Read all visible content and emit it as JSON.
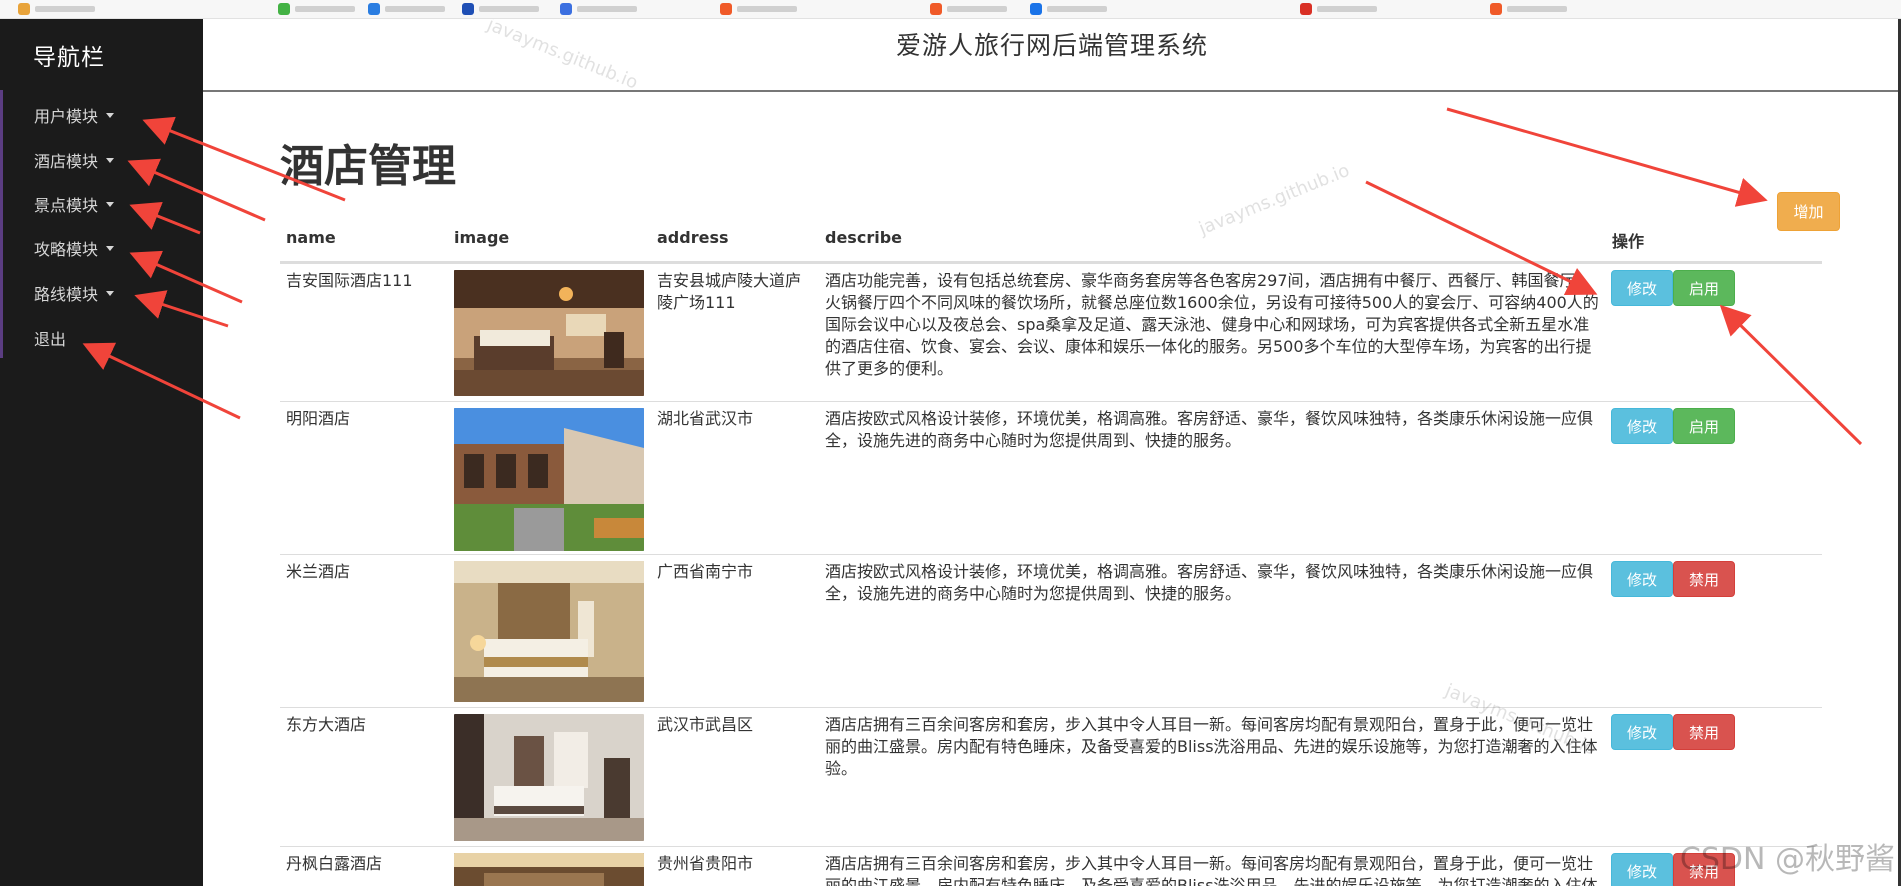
{
  "sidebar": {
    "title": "导航栏",
    "items": [
      {
        "label": "用户模块",
        "caret": true
      },
      {
        "label": "酒店模块",
        "caret": true
      },
      {
        "label": "景点模块",
        "caret": true
      },
      {
        "label": "攻略模块",
        "caret": true
      },
      {
        "label": "路线模块",
        "caret": true
      },
      {
        "label": "退出",
        "caret": false
      }
    ]
  },
  "header": {
    "title": "爱游人旅行网后端管理系统"
  },
  "main": {
    "page_title": "酒店管理",
    "add_button": "增加",
    "columns": [
      "name",
      "image",
      "address",
      "describe",
      "操作"
    ],
    "rows": [
      {
        "name": "吉安国际酒店111",
        "address": "吉安县城庐陵大道庐陵广场111",
        "describe": "酒店功能完善，设有包括总统套房、豪华商务套房等各色客房297间，酒店拥有中餐厅、西餐厅、韩国餐厅、火锅餐厅四个不同风味的餐饮场所，就餐总座位数1600余位，另设有可接待500人的宴会厅、可容纳400人的国际会议中心以及夜总会、spa桑拿及足道、露天泳池、健身中心和网球场，可为宾客提供各式全新五星水准的酒店住宿、饮食、宴会、会议、康体和娱乐一体化的服务。另500多个车位的大型停车场，为宾客的出行提供了更多的便利。",
        "edit": "修改",
        "toggle": "启用",
        "toggle_state": "on",
        "image_icon": "hotel-room-photo"
      },
      {
        "name": "明阳酒店",
        "address": "湖北省武汉市",
        "describe": "酒店按欧式风格设计装修，环境优美，格调高雅。客房舒适、豪华，餐饮风味独特，各类康乐休闲设施一应俱全，设施先进的商务中心随时为您提供周到、快捷的服务。",
        "edit": "修改",
        "toggle": "启用",
        "toggle_state": "on",
        "image_icon": "hotel-courtyard-photo"
      },
      {
        "name": "米兰酒店",
        "address": "广西省南宁市",
        "describe": "酒店按欧式风格设计装修，环境优美，格调高雅。客房舒适、豪华，餐饮风味独特，各类康乐休闲设施一应俱全，设施先进的商务中心随时为您提供周到、快捷的服务。",
        "edit": "修改",
        "toggle": "禁用",
        "toggle_state": "off",
        "image_icon": "hotel-bedroom-photo"
      },
      {
        "name": "东方大酒店",
        "address": "武汉市武昌区",
        "describe": "酒店店拥有三百余间客房和套房，步入其中令人耳目一新。每间客房均配有景观阳台，置身于此，便可一览壮丽的曲江盛景。房内配有特色睡床，及备受喜爱的Bliss洗浴用品、先进的娱乐设施等，为您打造潮奢的入住体验。",
        "edit": "修改",
        "toggle": "禁用",
        "toggle_state": "off",
        "image_icon": "hotel-suite-photo"
      },
      {
        "name": "丹枫白露酒店",
        "address": "贵州省贵阳市",
        "describe": "酒店店拥有三百余间客房和套房，步入其中令人耳目一新。每间客房均配有景观阳台，置身于此，便可一览壮丽的曲江盛景。房内配有特色睡床，及备受喜爱的Bliss洗浴用品、先进的娱乐设施等，为您打造潮奢的入住体验。",
        "edit": "修改",
        "toggle": "禁用",
        "toggle_state": "off",
        "image_icon": "hotel-lobby-photo"
      }
    ]
  },
  "watermark": "javayms.github.io",
  "credit": "CSDN @秋野酱",
  "colors": {
    "sidebar_bg": "#1b1b1b",
    "add": "#f0ad4e",
    "edit": "#5bc0de",
    "enable": "#5cb85c",
    "disable": "#d9534f",
    "annotation_arrow": "#f0443a"
  }
}
